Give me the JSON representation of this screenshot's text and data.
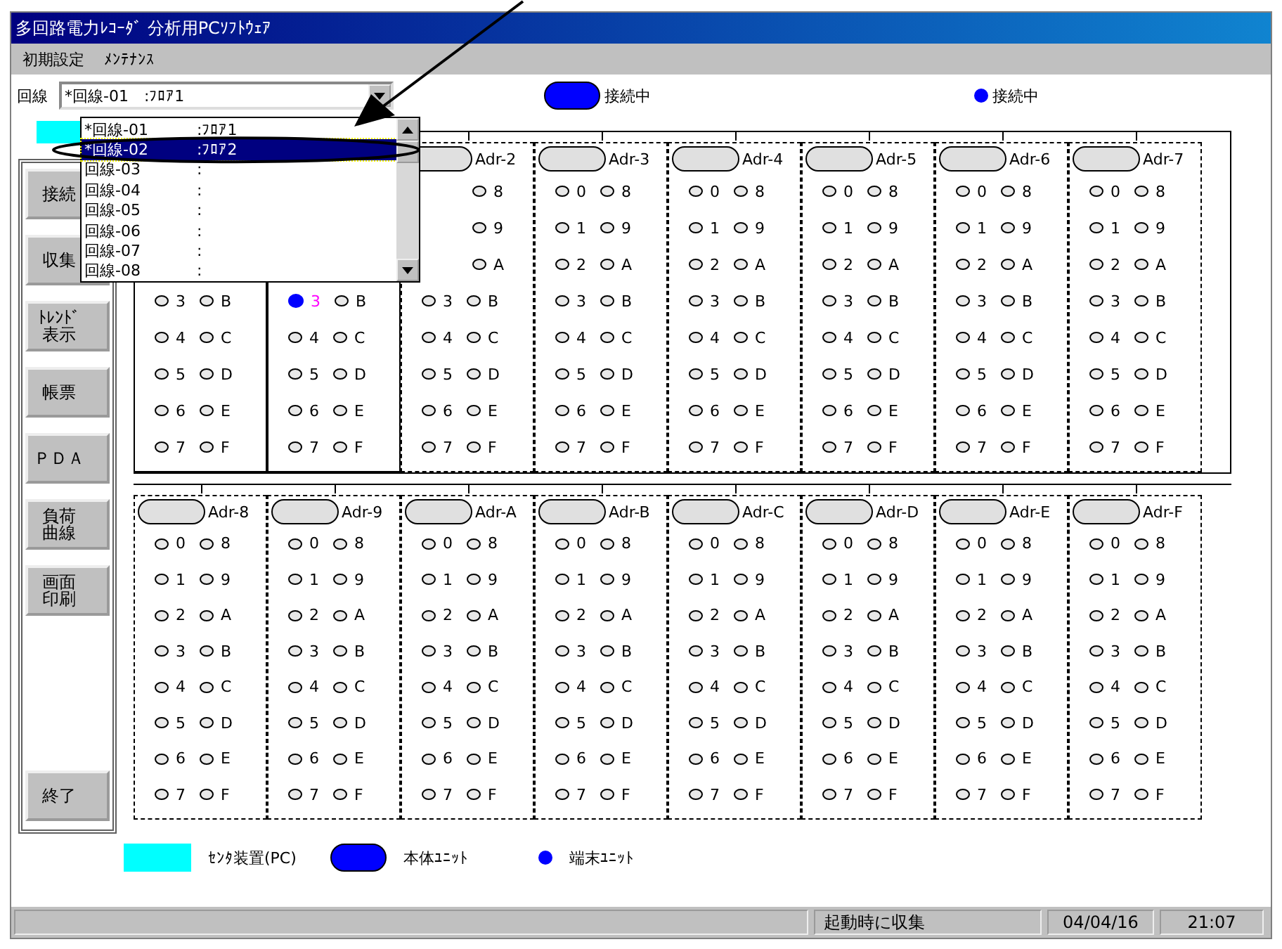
{
  "window": {
    "title": "多回路電力ﾚｺｰﾀﾞ 分析用PCｿﾌﾄｳｪｱ"
  },
  "menu": [
    "初期設定",
    "ﾒﾝﾃﾅﾝｽ"
  ],
  "line_select": {
    "label": "回線",
    "value": "*回線-01　:ﾌﾛｱ1"
  },
  "indicators": [
    {
      "kind": "pill",
      "label": "接続中"
    },
    {
      "kind": "dot",
      "label": "接続中"
    }
  ],
  "dropdown": {
    "items": [
      {
        "name": "*回線-01",
        "detail": ":ﾌﾛｱ1",
        "selected": false
      },
      {
        "name": "*回線-02",
        "detail": ":ﾌﾛｱ2",
        "selected": true
      },
      {
        "name": "回線-03",
        "detail": ":",
        "selected": false
      },
      {
        "name": "回線-04",
        "detail": ":",
        "selected": false
      },
      {
        "name": "回線-05",
        "detail": ":",
        "selected": false
      },
      {
        "name": "回線-06",
        "detail": ":",
        "selected": false
      },
      {
        "name": "回線-07",
        "detail": ":",
        "selected": false
      },
      {
        "name": "回線-08",
        "detail": ":",
        "selected": false
      }
    ]
  },
  "buttons": [
    [
      "接続"
    ],
    [
      "収集"
    ],
    [
      "ﾄﾚﾝﾄﾞ",
      "表示"
    ],
    [
      "帳票"
    ],
    [
      "ＰＤＡ"
    ],
    [
      "負荷",
      "曲線"
    ],
    [
      "画面",
      "印刷"
    ]
  ],
  "exit_button": "終了",
  "unit_rows": [
    [
      {
        "connected": true,
        "rows": [
          [
            {
              "label": "3",
              "on": false
            },
            {
              "label": "B",
              "on": false
            }
          ],
          [
            {
              "label": "4",
              "on": false
            },
            {
              "label": "C",
              "on": false
            }
          ],
          [
            {
              "label": "5",
              "on": false
            },
            {
              "label": "D",
              "on": false
            }
          ],
          [
            {
              "label": "6",
              "on": false
            },
            {
              "label": "E",
              "on": false
            }
          ],
          [
            {
              "label": "7",
              "on": false
            },
            {
              "label": "F",
              "on": false
            }
          ]
        ]
      },
      {
        "connected": true,
        "rows": [
          [
            {
              "label": "3",
              "on": true
            },
            {
              "label": "B",
              "on": false
            }
          ],
          [
            {
              "label": "4",
              "on": false
            },
            {
              "label": "C",
              "on": false
            }
          ],
          [
            {
              "label": "5",
              "on": false
            },
            {
              "label": "D",
              "on": false
            }
          ],
          [
            {
              "label": "6",
              "on": false
            },
            {
              "label": "E",
              "on": false
            }
          ],
          [
            {
              "label": "7",
              "on": false
            },
            {
              "label": "F",
              "on": false
            }
          ]
        ]
      },
      {
        "label": "Adr-2",
        "on": false,
        "connected": false,
        "rows": [
          [
            {
              "label": "8",
              "on": false
            }
          ],
          [
            {
              "label": "9",
              "on": false
            }
          ],
          [
            {
              "label": "A",
              "on": false
            }
          ],
          [
            {
              "label": "3",
              "on": false
            },
            {
              "label": "B",
              "on": false
            }
          ],
          [
            {
              "label": "4",
              "on": false
            },
            {
              "label": "C",
              "on": false
            }
          ],
          [
            {
              "label": "5",
              "on": false
            },
            {
              "label": "D",
              "on": false
            }
          ],
          [
            {
              "label": "6",
              "on": false
            },
            {
              "label": "E",
              "on": false
            }
          ],
          [
            {
              "label": "7",
              "on": false
            },
            {
              "label": "F",
              "on": false
            }
          ]
        ]
      },
      {
        "label": "Adr-3",
        "on": false,
        "connected": false,
        "rows": [
          [
            {
              "label": "0",
              "on": false
            },
            {
              "label": "8",
              "on": false
            }
          ],
          [
            {
              "label": "1",
              "on": false
            },
            {
              "label": "9",
              "on": false
            }
          ],
          [
            {
              "label": "2",
              "on": false
            },
            {
              "label": "A",
              "on": false
            }
          ],
          [
            {
              "label": "3",
              "on": false
            },
            {
              "label": "B",
              "on": false
            }
          ],
          [
            {
              "label": "4",
              "on": false
            },
            {
              "label": "C",
              "on": false
            }
          ],
          [
            {
              "label": "5",
              "on": false
            },
            {
              "label": "D",
              "on": false
            }
          ],
          [
            {
              "label": "6",
              "on": false
            },
            {
              "label": "E",
              "on": false
            }
          ],
          [
            {
              "label": "7",
              "on": false
            },
            {
              "label": "F",
              "on": false
            }
          ]
        ]
      },
      {
        "label": "Adr-4",
        "on": false,
        "connected": false,
        "rows": [
          [
            {
              "label": "0",
              "on": false
            },
            {
              "label": "8",
              "on": false
            }
          ],
          [
            {
              "label": "1",
              "on": false
            },
            {
              "label": "9",
              "on": false
            }
          ],
          [
            {
              "label": "2",
              "on": false
            },
            {
              "label": "A",
              "on": false
            }
          ],
          [
            {
              "label": "3",
              "on": false
            },
            {
              "label": "B",
              "on": false
            }
          ],
          [
            {
              "label": "4",
              "on": false
            },
            {
              "label": "C",
              "on": false
            }
          ],
          [
            {
              "label": "5",
              "on": false
            },
            {
              "label": "D",
              "on": false
            }
          ],
          [
            {
              "label": "6",
              "on": false
            },
            {
              "label": "E",
              "on": false
            }
          ],
          [
            {
              "label": "7",
              "on": false
            },
            {
              "label": "F",
              "on": false
            }
          ]
        ]
      },
      {
        "label": "Adr-5",
        "on": false,
        "connected": false,
        "rows": [
          [
            {
              "label": "0",
              "on": false
            },
            {
              "label": "8",
              "on": false
            }
          ],
          [
            {
              "label": "1",
              "on": false
            },
            {
              "label": "9",
              "on": false
            }
          ],
          [
            {
              "label": "2",
              "on": false
            },
            {
              "label": "A",
              "on": false
            }
          ],
          [
            {
              "label": "3",
              "on": false
            },
            {
              "label": "B",
              "on": false
            }
          ],
          [
            {
              "label": "4",
              "on": false
            },
            {
              "label": "C",
              "on": false
            }
          ],
          [
            {
              "label": "5",
              "on": false
            },
            {
              "label": "D",
              "on": false
            }
          ],
          [
            {
              "label": "6",
              "on": false
            },
            {
              "label": "E",
              "on": false
            }
          ],
          [
            {
              "label": "7",
              "on": false
            },
            {
              "label": "F",
              "on": false
            }
          ]
        ]
      },
      {
        "label": "Adr-6",
        "on": false,
        "connected": false,
        "rows": [
          [
            {
              "label": "0",
              "on": false
            },
            {
              "label": "8",
              "on": false
            }
          ],
          [
            {
              "label": "1",
              "on": false
            },
            {
              "label": "9",
              "on": false
            }
          ],
          [
            {
              "label": "2",
              "on": false
            },
            {
              "label": "A",
              "on": false
            }
          ],
          [
            {
              "label": "3",
              "on": false
            },
            {
              "label": "B",
              "on": false
            }
          ],
          [
            {
              "label": "4",
              "on": false
            },
            {
              "label": "C",
              "on": false
            }
          ],
          [
            {
              "label": "5",
              "on": false
            },
            {
              "label": "D",
              "on": false
            }
          ],
          [
            {
              "label": "6",
              "on": false
            },
            {
              "label": "E",
              "on": false
            }
          ],
          [
            {
              "label": "7",
              "on": false
            },
            {
              "label": "F",
              "on": false
            }
          ]
        ]
      },
      {
        "label": "Adr-7",
        "on": false,
        "connected": false,
        "rows": [
          [
            {
              "label": "0",
              "on": false
            },
            {
              "label": "8",
              "on": false
            }
          ],
          [
            {
              "label": "1",
              "on": false
            },
            {
              "label": "9",
              "on": false
            }
          ],
          [
            {
              "label": "2",
              "on": false
            },
            {
              "label": "A",
              "on": false
            }
          ],
          [
            {
              "label": "3",
              "on": false
            },
            {
              "label": "B",
              "on": false
            }
          ],
          [
            {
              "label": "4",
              "on": false
            },
            {
              "label": "C",
              "on": false
            }
          ],
          [
            {
              "label": "5",
              "on": false
            },
            {
              "label": "D",
              "on": false
            }
          ],
          [
            {
              "label": "6",
              "on": false
            },
            {
              "label": "E",
              "on": false
            }
          ],
          [
            {
              "label": "7",
              "on": false
            },
            {
              "label": "F",
              "on": false
            }
          ]
        ]
      }
    ],
    [
      {
        "label": "Adr-8",
        "on": false,
        "connected": false,
        "rows": [
          [
            {
              "label": "0",
              "on": false
            },
            {
              "label": "8",
              "on": false
            }
          ],
          [
            {
              "label": "1",
              "on": false
            },
            {
              "label": "9",
              "on": false
            }
          ],
          [
            {
              "label": "2",
              "on": false
            },
            {
              "label": "A",
              "on": false
            }
          ],
          [
            {
              "label": "3",
              "on": false
            },
            {
              "label": "B",
              "on": false
            }
          ],
          [
            {
              "label": "4",
              "on": false
            },
            {
              "label": "C",
              "on": false
            }
          ],
          [
            {
              "label": "5",
              "on": false
            },
            {
              "label": "D",
              "on": false
            }
          ],
          [
            {
              "label": "6",
              "on": false
            },
            {
              "label": "E",
              "on": false
            }
          ],
          [
            {
              "label": "7",
              "on": false
            },
            {
              "label": "F",
              "on": false
            }
          ]
        ]
      },
      {
        "label": "Adr-9",
        "on": false,
        "connected": false,
        "rows": [
          [
            {
              "label": "0",
              "on": false
            },
            {
              "label": "8",
              "on": false
            }
          ],
          [
            {
              "label": "1",
              "on": false
            },
            {
              "label": "9",
              "on": false
            }
          ],
          [
            {
              "label": "2",
              "on": false
            },
            {
              "label": "A",
              "on": false
            }
          ],
          [
            {
              "label": "3",
              "on": false
            },
            {
              "label": "B",
              "on": false
            }
          ],
          [
            {
              "label": "4",
              "on": false
            },
            {
              "label": "C",
              "on": false
            }
          ],
          [
            {
              "label": "5",
              "on": false
            },
            {
              "label": "D",
              "on": false
            }
          ],
          [
            {
              "label": "6",
              "on": false
            },
            {
              "label": "E",
              "on": false
            }
          ],
          [
            {
              "label": "7",
              "on": false
            },
            {
              "label": "F",
              "on": false
            }
          ]
        ]
      },
      {
        "label": "Adr-A",
        "on": false,
        "connected": false,
        "rows": [
          [
            {
              "label": "0",
              "on": false
            },
            {
              "label": "8",
              "on": false
            }
          ],
          [
            {
              "label": "1",
              "on": false
            },
            {
              "label": "9",
              "on": false
            }
          ],
          [
            {
              "label": "2",
              "on": false
            },
            {
              "label": "A",
              "on": false
            }
          ],
          [
            {
              "label": "3",
              "on": false
            },
            {
              "label": "B",
              "on": false
            }
          ],
          [
            {
              "label": "4",
              "on": false
            },
            {
              "label": "C",
              "on": false
            }
          ],
          [
            {
              "label": "5",
              "on": false
            },
            {
              "label": "D",
              "on": false
            }
          ],
          [
            {
              "label": "6",
              "on": false
            },
            {
              "label": "E",
              "on": false
            }
          ],
          [
            {
              "label": "7",
              "on": false
            },
            {
              "label": "F",
              "on": false
            }
          ]
        ]
      },
      {
        "label": "Adr-B",
        "on": false,
        "connected": false,
        "rows": [
          [
            {
              "label": "0",
              "on": false
            },
            {
              "label": "8",
              "on": false
            }
          ],
          [
            {
              "label": "1",
              "on": false
            },
            {
              "label": "9",
              "on": false
            }
          ],
          [
            {
              "label": "2",
              "on": false
            },
            {
              "label": "A",
              "on": false
            }
          ],
          [
            {
              "label": "3",
              "on": false
            },
            {
              "label": "B",
              "on": false
            }
          ],
          [
            {
              "label": "4",
              "on": false
            },
            {
              "label": "C",
              "on": false
            }
          ],
          [
            {
              "label": "5",
              "on": false
            },
            {
              "label": "D",
              "on": false
            }
          ],
          [
            {
              "label": "6",
              "on": false
            },
            {
              "label": "E",
              "on": false
            }
          ],
          [
            {
              "label": "7",
              "on": false
            },
            {
              "label": "F",
              "on": false
            }
          ]
        ]
      },
      {
        "label": "Adr-C",
        "on": false,
        "connected": false,
        "rows": [
          [
            {
              "label": "0",
              "on": false
            },
            {
              "label": "8",
              "on": false
            }
          ],
          [
            {
              "label": "1",
              "on": false
            },
            {
              "label": "9",
              "on": false
            }
          ],
          [
            {
              "label": "2",
              "on": false
            },
            {
              "label": "A",
              "on": false
            }
          ],
          [
            {
              "label": "3",
              "on": false
            },
            {
              "label": "B",
              "on": false
            }
          ],
          [
            {
              "label": "4",
              "on": false
            },
            {
              "label": "C",
              "on": false
            }
          ],
          [
            {
              "label": "5",
              "on": false
            },
            {
              "label": "D",
              "on": false
            }
          ],
          [
            {
              "label": "6",
              "on": false
            },
            {
              "label": "E",
              "on": false
            }
          ],
          [
            {
              "label": "7",
              "on": false
            },
            {
              "label": "F",
              "on": false
            }
          ]
        ]
      },
      {
        "label": "Adr-D",
        "on": false,
        "connected": false,
        "rows": [
          [
            {
              "label": "0",
              "on": false
            },
            {
              "label": "8",
              "on": false
            }
          ],
          [
            {
              "label": "1",
              "on": false
            },
            {
              "label": "9",
              "on": false
            }
          ],
          [
            {
              "label": "2",
              "on": false
            },
            {
              "label": "A",
              "on": false
            }
          ],
          [
            {
              "label": "3",
              "on": false
            },
            {
              "label": "B",
              "on": false
            }
          ],
          [
            {
              "label": "4",
              "on": false
            },
            {
              "label": "C",
              "on": false
            }
          ],
          [
            {
              "label": "5",
              "on": false
            },
            {
              "label": "D",
              "on": false
            }
          ],
          [
            {
              "label": "6",
              "on": false
            },
            {
              "label": "E",
              "on": false
            }
          ],
          [
            {
              "label": "7",
              "on": false
            },
            {
              "label": "F",
              "on": false
            }
          ]
        ]
      },
      {
        "label": "Adr-E",
        "on": false,
        "connected": false,
        "rows": [
          [
            {
              "label": "0",
              "on": false
            },
            {
              "label": "8",
              "on": false
            }
          ],
          [
            {
              "label": "1",
              "on": false
            },
            {
              "label": "9",
              "on": false
            }
          ],
          [
            {
              "label": "2",
              "on": false
            },
            {
              "label": "A",
              "on": false
            }
          ],
          [
            {
              "label": "3",
              "on": false
            },
            {
              "label": "B",
              "on": false
            }
          ],
          [
            {
              "label": "4",
              "on": false
            },
            {
              "label": "C",
              "on": false
            }
          ],
          [
            {
              "label": "5",
              "on": false
            },
            {
              "label": "D",
              "on": false
            }
          ],
          [
            {
              "label": "6",
              "on": false
            },
            {
              "label": "E",
              "on": false
            }
          ],
          [
            {
              "label": "7",
              "on": false
            },
            {
              "label": "F",
              "on": false
            }
          ]
        ]
      },
      {
        "label": "Adr-F",
        "on": false,
        "connected": false,
        "rows": [
          [
            {
              "label": "0",
              "on": false
            },
            {
              "label": "8",
              "on": false
            }
          ],
          [
            {
              "label": "1",
              "on": false
            },
            {
              "label": "9",
              "on": false
            }
          ],
          [
            {
              "label": "2",
              "on": false
            },
            {
              "label": "A",
              "on": false
            }
          ],
          [
            {
              "label": "3",
              "on": false
            },
            {
              "label": "B",
              "on": false
            }
          ],
          [
            {
              "label": "4",
              "on": false
            },
            {
              "label": "C",
              "on": false
            }
          ],
          [
            {
              "label": "5",
              "on": false
            },
            {
              "label": "D",
              "on": false
            }
          ],
          [
            {
              "label": "6",
              "on": false
            },
            {
              "label": "E",
              "on": false
            }
          ],
          [
            {
              "label": "7",
              "on": false
            },
            {
              "label": "F",
              "on": false
            }
          ]
        ]
      }
    ]
  ],
  "legend": [
    {
      "kind": "box",
      "label": "ｾﾝﾀ装置(PC)"
    },
    {
      "kind": "pill",
      "label": "本体ﾕﾆｯﾄ"
    },
    {
      "kind": "dot",
      "label": "端末ﾕﾆｯﾄ"
    }
  ],
  "status_bar": [
    "起動時に収集",
    "04/04/16",
    "21:07"
  ],
  "annotation": {
    "kind": "arrow-and-ellipse"
  }
}
